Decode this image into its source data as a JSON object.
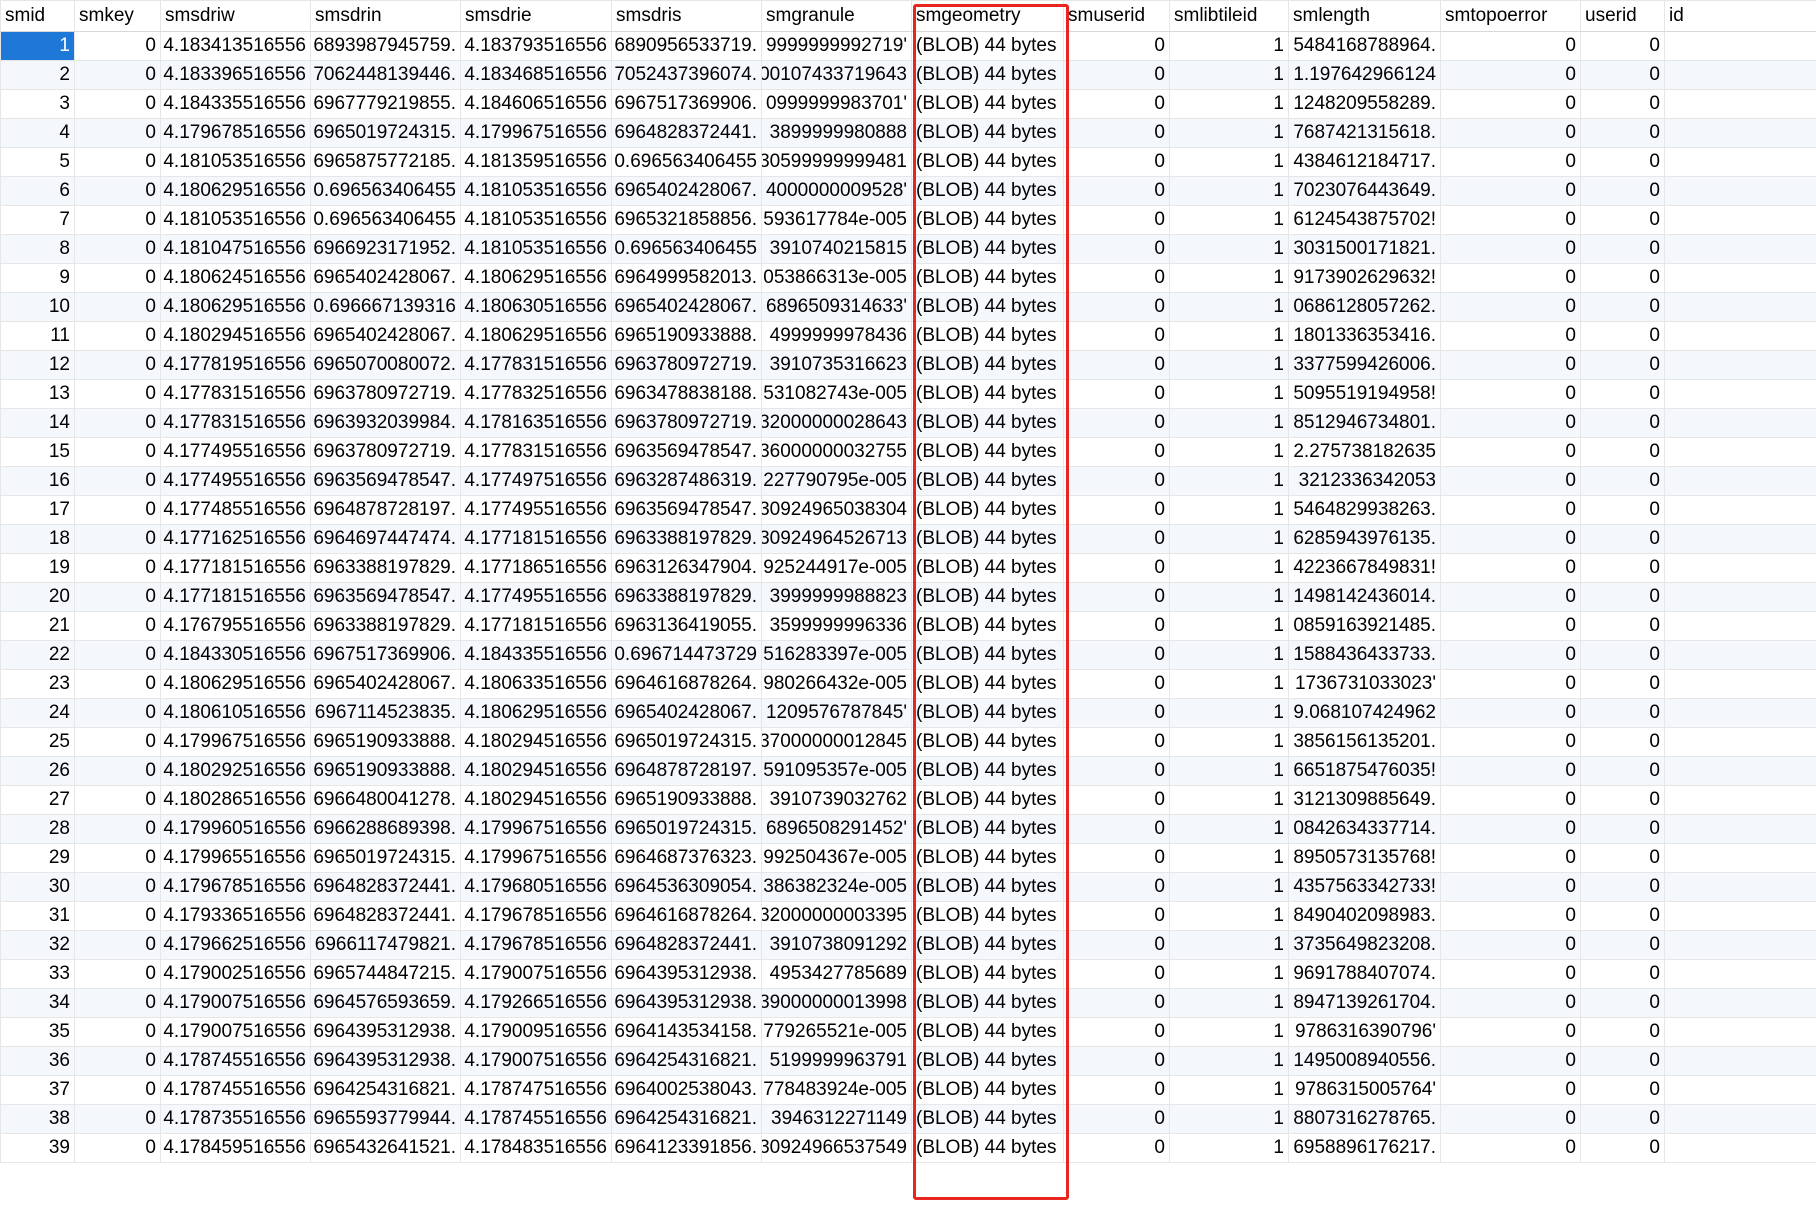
{
  "columns": [
    "smid",
    "smkey",
    "smsdriw",
    "smsdrin",
    "smsdrie",
    "smsdris",
    "smgranule",
    "smgeometry",
    "smuserid",
    "smlibtileid",
    "smlength",
    "smtopoerror",
    "userid",
    "id"
  ],
  "rows": [
    [
      "1",
      "0",
      "4.183413516556",
      ".6893987945759",
      "4.183793516556",
      ".6890956533719",
      "'9999999992719",
      "(BLOB) 44 bytes",
      "0",
      "1",
      ".5484168788964",
      "0",
      "0",
      ""
    ],
    [
      "2",
      "0",
      "4.183396516556",
      ".7062448139446",
      "4.183468516556",
      ".7052437396074",
      "00107433719643",
      "(BLOB) 44 bytes",
      "0",
      "1",
      "1.197642966124",
      "0",
      "0",
      ""
    ],
    [
      "3",
      "0",
      "4.184335516556",
      ".6967779219855",
      "4.184606516556",
      ".6967517369906",
      "'0999999983701",
      "(BLOB) 44 bytes",
      "0",
      "1",
      ".1248209558289",
      "0",
      "0",
      ""
    ],
    [
      "4",
      "0",
      "4.179678516556",
      ".6965019724315",
      "4.179967516556",
      ".6964828372441",
      "3899999980888",
      "(BLOB) 44 bytes",
      "0",
      "1",
      ".7687421315618",
      "0",
      "0",
      ""
    ],
    [
      "5",
      "0",
      "4.181053516556",
      ".6965875772185",
      "4.181359516556",
      "0.696563406455",
      "30599999999481",
      "(BLOB) 44 bytes",
      "0",
      "1",
      ".4384612184717",
      "0",
      "0",
      ""
    ],
    [
      "6",
      "0",
      "4.180629516556",
      "0.696563406455",
      "4.181053516556",
      ".6965402428067",
      "'4000000009528",
      "(BLOB) 44 bytes",
      "0",
      "1",
      ".7023076443649",
      "0",
      "0",
      ""
    ],
    [
      "7",
      "0",
      "4.181053516556",
      "0.696563406455",
      "4.181053516556",
      ".6965321858856",
      "593617784e-005",
      "(BLOB) 44 bytes",
      "0",
      "1",
      "!6124543875702",
      "0",
      "0",
      ""
    ],
    [
      "8",
      "0",
      "4.181047516556",
      ".6966923171952",
      "4.181053516556",
      "0.696563406455",
      "3910740215815",
      "(BLOB) 44 bytes",
      "0",
      "1",
      ".3031500171821",
      "0",
      "0",
      ""
    ],
    [
      "9",
      "0",
      "4.180624516556",
      ".6965402428067",
      "4.180629516556",
      ".6964999582013",
      "053866313e-005",
      "(BLOB) 44 bytes",
      "0",
      "1",
      "!9173902629632",
      "0",
      "0",
      ""
    ],
    [
      "10",
      "0",
      "4.180629516556",
      "0.696667139316",
      "4.180630516556",
      ".6965402428067",
      "'6896509314633",
      "(BLOB) 44 bytes",
      "0",
      "1",
      ".0686128057262",
      "0",
      "0",
      ""
    ],
    [
      "11",
      "0",
      "4.180294516556",
      ".6965402428067",
      "4.180629516556",
      ".6965190933888",
      "4999999978436",
      "(BLOB) 44 bytes",
      "0",
      "1",
      ".1801336353416",
      "0",
      "0",
      ""
    ],
    [
      "12",
      "0",
      "4.177819516556",
      ".6965070080072",
      "4.177831516556",
      ".6963780972719",
      "3910735316623",
      "(BLOB) 44 bytes",
      "0",
      "1",
      ".3377599426006",
      "0",
      "0",
      ""
    ],
    [
      "13",
      "0",
      "4.177831516556",
      ".6963780972719",
      "4.177832516556",
      ".6963478838188",
      "531082743e-005",
      "(BLOB) 44 bytes",
      "0",
      "1",
      "!5095519194958",
      "0",
      "0",
      ""
    ],
    [
      "14",
      "0",
      "4.177831516556",
      ".6963932039984",
      "4.178163516556",
      ".6963780972719",
      "32000000028643",
      "(BLOB) 44 bytes",
      "0",
      "1",
      ".8512946734801",
      "0",
      "0",
      ""
    ],
    [
      "15",
      "0",
      "4.177495516556",
      ".6963780972719",
      "4.177831516556",
      ".6963569478547",
      "36000000032755",
      "(BLOB) 44 bytes",
      "0",
      "1",
      "2.275738182635",
      "0",
      "0",
      ""
    ],
    [
      "16",
      "0",
      "4.177495516556",
      ".6963569478547",
      "4.177497516556",
      ".6963287486319",
      "227790795e-005",
      "(BLOB) 44 bytes",
      "0",
      "1",
      "3212336342053",
      "0",
      "0",
      ""
    ],
    [
      "17",
      "0",
      "4.177485516556",
      ".6964878728197",
      "4.177495516556",
      ".6963569478547",
      "30924965038304",
      "(BLOB) 44 bytes",
      "0",
      "1",
      ".5464829938263",
      "0",
      "0",
      ""
    ],
    [
      "18",
      "0",
      "4.177162516556",
      ".6964697447474",
      "4.177181516556",
      ".6963388197829",
      "30924964526713",
      "(BLOB) 44 bytes",
      "0",
      "1",
      ".6285943976135",
      "0",
      "0",
      ""
    ],
    [
      "19",
      "0",
      "4.177181516556",
      ".6963388197829",
      "4.177186516556",
      ".6963126347904",
      "925244917e-005",
      "(BLOB) 44 bytes",
      "0",
      "1",
      "!4223667849831",
      "0",
      "0",
      ""
    ],
    [
      "20",
      "0",
      "4.177181516556",
      ".6963569478547",
      "4.177495516556",
      ".6963388197829",
      "3999999988823",
      "(BLOB) 44 bytes",
      "0",
      "1",
      ".1498142436014",
      "0",
      "0",
      ""
    ],
    [
      "21",
      "0",
      "4.176795516556",
      ".6963388197829",
      "4.177181516556",
      ".6963136419055",
      "3599999996336",
      "(BLOB) 44 bytes",
      "0",
      "1",
      ".0859163921485",
      "0",
      "0",
      ""
    ],
    [
      "22",
      "0",
      "4.184330516556",
      ".6967517369906",
      "4.184335516556",
      "0.696714473729",
      "516283397e-005",
      "(BLOB) 44 bytes",
      "0",
      "1",
      ".1588436433733",
      "0",
      "0",
      ""
    ],
    [
      "23",
      "0",
      "4.180629516556",
      ".6965402428067",
      "4.180633516556",
      ".6964616878264",
      "980266432e-005",
      "(BLOB) 44 bytes",
      "0",
      "1",
      "'1736731033023",
      "0",
      "0",
      ""
    ],
    [
      "24",
      "0",
      "4.180610516556",
      ".6967114523835",
      "4.180629516556",
      ".6965402428067",
      "'1209576787845",
      "(BLOB) 44 bytes",
      "0",
      "1",
      "9.068107424962",
      "0",
      "0",
      ""
    ],
    [
      "25",
      "0",
      "4.179967516556",
      ".6965190933888",
      "4.180294516556",
      ".6965019724315",
      "37000000012845",
      "(BLOB) 44 bytes",
      "0",
      "1",
      ".3856156135201",
      "0",
      "0",
      ""
    ],
    [
      "26",
      "0",
      "4.180292516556",
      ".6965190933888",
      "4.180294516556",
      ".6964878728197",
      "591095357e-005",
      "(BLOB) 44 bytes",
      "0",
      "1",
      "!6651875476035",
      "0",
      "0",
      ""
    ],
    [
      "27",
      "0",
      "4.180286516556",
      ".6966480041278",
      "4.180294516556",
      ".6965190933888",
      "3910739032762",
      "(BLOB) 44 bytes",
      "0",
      "1",
      ".3121309885649",
      "0",
      "0",
      ""
    ],
    [
      "28",
      "0",
      "4.179960516556",
      ".6966288689398",
      "4.179967516556",
      ".6965019724315",
      "'6896508291452",
      "(BLOB) 44 bytes",
      "0",
      "1",
      ".0842634337714",
      "0",
      "0",
      ""
    ],
    [
      "29",
      "0",
      "4.179965516556",
      ".6965019724315",
      "4.179967516556",
      ".6964687376323",
      "992504367e-005",
      "(BLOB) 44 bytes",
      "0",
      "1",
      "!8950573135768",
      "0",
      "0",
      ""
    ],
    [
      "30",
      "0",
      "4.179678516556",
      ".6964828372441",
      "4.179680516556",
      ".6964536309054",
      "386382324e-005",
      "(BLOB) 44 bytes",
      "0",
      "1",
      "!4357563342733",
      "0",
      "0",
      ""
    ],
    [
      "31",
      "0",
      "4.179336516556",
      ".6964828372441",
      "4.179678516556",
      ".6964616878264",
      "32000000003395",
      "(BLOB) 44 bytes",
      "0",
      "1",
      ".8490402098983",
      "0",
      "0",
      ""
    ],
    [
      "32",
      "0",
      "4.179662516556",
      ".6966117479821",
      "4.179678516556",
      ".6964828372441",
      "3910738091292",
      "(BLOB) 44 bytes",
      "0",
      "1",
      ".3735649823208",
      "0",
      "0",
      ""
    ],
    [
      "33",
      "0",
      "4.179002516556",
      ".6965744847215",
      "4.179007516556",
      ".6964395312938",
      "4953427785689",
      "(BLOB) 44 bytes",
      "0",
      "1",
      ".9691788407074",
      "0",
      "0",
      ""
    ],
    [
      "34",
      "0",
      "4.179007516556",
      ".6964576593659",
      "4.179266516556",
      ".6964395312938",
      "39000000013998",
      "(BLOB) 44 bytes",
      "0",
      "1",
      ".8947139261704",
      "0",
      "0",
      ""
    ],
    [
      "35",
      "0",
      "4.179007516556",
      ".6964395312938",
      "4.179009516556",
      ".6964143534158",
      "779265521e-005",
      "(BLOB) 44 bytes",
      "0",
      "1",
      "'9786316390796",
      "0",
      "0",
      ""
    ],
    [
      "36",
      "0",
      "4.178745516556",
      ".6964395312938",
      "4.179007516556",
      ".6964254316821",
      "5199999963791",
      "(BLOB) 44 bytes",
      "0",
      "1",
      ".1495008940556",
      "0",
      "0",
      ""
    ],
    [
      "37",
      "0",
      "4.178745516556",
      ".6964254316821",
      "4.178747516556",
      ".6964002538043",
      "778483924e-005",
      "(BLOB) 44 bytes",
      "0",
      "1",
      "'9786315005764",
      "0",
      "0",
      ""
    ],
    [
      "38",
      "0",
      "4.178735516556",
      ".6965593779944",
      "4.178745516556",
      ".6964254316821",
      "3946312271149",
      "(BLOB) 44 bytes",
      "0",
      "1",
      ".8807316278765",
      "0",
      "0",
      ""
    ],
    [
      "39",
      "0",
      "4.178459516556",
      ".6965432641521",
      "4.178483516556",
      ".6964123391856",
      "30924966537549",
      "(BLOB) 44 bytes",
      "0",
      "1",
      ".6958896176217",
      "0",
      "0",
      ""
    ]
  ],
  "selected_row": 0,
  "highlighted_column": "smgeometry",
  "colors": {
    "selection": "#1e78d7",
    "highlight_box": "#e8251f",
    "alt_row": "#f4f7fc"
  }
}
